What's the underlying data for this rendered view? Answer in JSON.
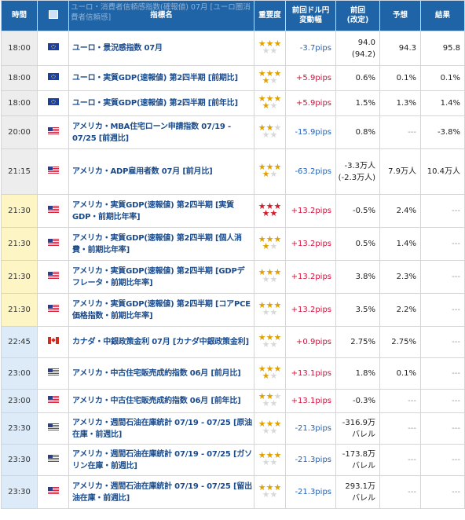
{
  "header": {
    "time": "時間",
    "flag": "国",
    "name": "指標名",
    "importance": "重要度",
    "pips_line1": "前回ドル円",
    "pips_line2": "変動幅",
    "prev_line1": "前回",
    "prev_line2": "(改定)",
    "forecast": "予想",
    "result": "結果",
    "behind_name": "ユーロ・消費者信頼感指数(確報値) 07月 [ユーロ圏消費者信頼感]"
  },
  "rows": [
    {
      "time": "18:00",
      "flag": "eu",
      "name": "ユーロ・景況感指数 07月",
      "stars": "3",
      "pips": "-3.7pips",
      "dir": "dn",
      "prev": "94.0",
      "prev2": "(94.2)",
      "forecast": "94.3",
      "result": "95.8"
    },
    {
      "time": "18:00",
      "flag": "eu",
      "name": "ユーロ・実質GDP(速報値) 第2四半期 [前期比]",
      "stars": "4",
      "pips": "+5.9pips",
      "dir": "up",
      "prev": "0.6%",
      "prev2": "",
      "forecast": "0.1%",
      "result": "0.1%"
    },
    {
      "time": "18:00",
      "flag": "eu",
      "name": "ユーロ・実質GDP(速報値) 第2四半期 [前年比]",
      "stars": "4",
      "pips": "+5.9pips",
      "dir": "up",
      "prev": "1.5%",
      "prev2": "",
      "forecast": "1.3%",
      "result": "1.4%"
    },
    {
      "time": "20:00",
      "flag": "us",
      "name": "アメリカ・MBA住宅ローン申請指数 07/19 - 07/25 [前週比]",
      "stars": "2",
      "pips": "-15.9pips",
      "dir": "dn",
      "prev": "0.8%",
      "prev2": "",
      "forecast": "---",
      "result": "-3.8%"
    },
    {
      "time": "21:15",
      "flag": "us",
      "name": "アメリカ・ADP雇用者数 07月 [前月比]",
      "stars": "4",
      "pips": "-63.2pips",
      "dir": "dn",
      "prev": "-3.3万人",
      "prev2": "(-2.3万人)",
      "forecast": "7.9万人",
      "result": "10.4万人"
    },
    {
      "time": "21:30",
      "flag": "us",
      "name": "アメリカ・実質GDP(速報値) 第2四半期 [実質GDP・前期比年率]",
      "stars": "5",
      "pips": "+13.2pips",
      "dir": "up",
      "prev": "-0.5%",
      "prev2": "",
      "forecast": "2.4%",
      "result": "---"
    },
    {
      "time": "21:30",
      "flag": "us",
      "name": "アメリカ・実質GDP(速報値) 第2四半期 [個人消費・前期比年率]",
      "stars": "4",
      "pips": "+13.2pips",
      "dir": "up",
      "prev": "0.5%",
      "prev2": "",
      "forecast": "1.4%",
      "result": "---"
    },
    {
      "time": "21:30",
      "flag": "us",
      "name": "アメリカ・実質GDP(速報値) 第2四半期 [GDPデフレータ・前期比年率]",
      "stars": "3",
      "pips": "+13.2pips",
      "dir": "up",
      "prev": "3.8%",
      "prev2": "",
      "forecast": "2.3%",
      "result": "---"
    },
    {
      "time": "21:30",
      "flag": "us",
      "name": "アメリカ・実質GDP(速報値) 第2四半期 [コアPCE価格指数・前期比年率]",
      "stars": "3",
      "pips": "+13.2pips",
      "dir": "up",
      "prev": "3.5%",
      "prev2": "",
      "forecast": "2.2%",
      "result": "---"
    },
    {
      "time": "22:45",
      "flag": "ca",
      "name": "カナダ・中銀政策金利 07月 [カナダ中銀政策金利]",
      "stars": "3",
      "pips": "+0.9pips",
      "dir": "up",
      "prev": "2.75%",
      "prev2": "",
      "forecast": "2.75%",
      "result": "---"
    },
    {
      "time": "23:00",
      "flag": "us",
      "name": "アメリカ・中古住宅販売成約指数 06月 [前月比]",
      "stars": "4",
      "pips": "+13.1pips",
      "dir": "up",
      "prev": "1.8%",
      "prev2": "",
      "forecast": "0.1%",
      "result": "---"
    },
    {
      "time": "23:00",
      "flag": "us",
      "name": "アメリカ・中古住宅販売成約指数 06月 [前年比]",
      "stars": "2",
      "pips": "+13.1pips",
      "dir": "up",
      "prev": "-0.3%",
      "prev2": "",
      "forecast": "---",
      "result": "---"
    },
    {
      "time": "23:30",
      "flag": "us",
      "name": "アメリカ・週間石油在庫統計 07/19 - 07/25 [原油在庫・前週比]",
      "stars": "3",
      "pips": "-21.3pips",
      "dir": "dn",
      "prev": "-316.9万バレル",
      "prev2": "",
      "forecast": "---",
      "result": "---"
    },
    {
      "time": "23:30",
      "flag": "us",
      "name": "アメリカ・週間石油在庫統計 07/19 - 07/25 [ガソリン在庫・前週比]",
      "stars": "3",
      "pips": "-21.3pips",
      "dir": "dn",
      "prev": "-173.8万バレル",
      "prev2": "",
      "forecast": "---",
      "result": "---"
    },
    {
      "time": "23:30",
      "flag": "us",
      "name": "アメリカ・週間石油在庫統計 07/19 - 07/25 [留出油在庫・前週比]",
      "stars": "3",
      "pips": "-21.3pips",
      "dir": "dn",
      "prev": "293.1万バレル",
      "prev2": "",
      "forecast": "---",
      "result": "---"
    }
  ]
}
